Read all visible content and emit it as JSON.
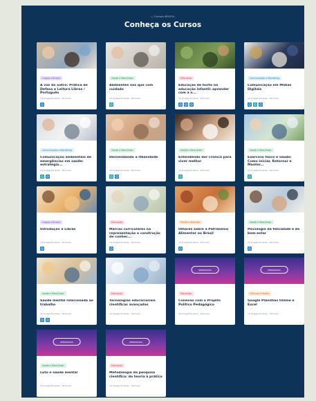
{
  "header": {
    "overline": "○ Cursos MOOCs",
    "title": "Conheça os Cursos"
  },
  "cards": [
    {
      "category": "Língua e Ensino",
      "cat": "lang",
      "title": "A voz do outro: Prática de Defesa e Leitura Libras / Português",
      "meta": "10 Cargas Horárias · 40 horas",
      "icons": [
        "blue"
      ],
      "image": "girl-studying"
    },
    {
      "category": "Saúde e Bem-Estar",
      "cat": "health",
      "title": "Ambientes nos que com cuidado",
      "meta": "10 Cargas Horárias · 30 horas",
      "icons": [
        "teal"
      ],
      "image": "hands-writing"
    },
    {
      "category": "Educação",
      "cat": "edu",
      "title": "Educação de horta na educação infantil: aprender com a n...",
      "meta": "10 Cargas Horárias · 30 horas",
      "icons": [
        "blue",
        "blue",
        "blue"
      ],
      "image": "garden-plants"
    },
    {
      "category": "Comunicação e Marketing",
      "cat": "comm",
      "title": "Comunicação em Mídias Digitais",
      "meta": "10 Cargas Horárias · 30 horas",
      "icons": [
        "blue",
        "teal",
        "blue"
      ],
      "image": "book-dark"
    },
    {
      "category": "Comunicação e Marketing",
      "cat": "comm",
      "title": "Comunicação ambientais de emergências em saúde: estratégia...",
      "meta": "10 Cargas Horárias · 30 horas",
      "icons": [
        "teal",
        "blue"
      ],
      "image": "paperwork"
    },
    {
      "category": "Saúde e Bem-Estar",
      "cat": "health",
      "title": "Desvendando a Obesidade",
      "meta": "10 Cargas Horárias · 30 horas",
      "icons": [
        "teal",
        "blue"
      ],
      "image": "belly"
    },
    {
      "category": "Saúde e Bem-Estar",
      "cat": "health",
      "title": "Entendendo dor crônica para viver melhor",
      "meta": "10 Cargas Horárias · 30 horas",
      "icons": [
        "teal"
      ],
      "image": "knee-pain"
    },
    {
      "category": "Saúde e Bem-Estar",
      "cat": "health",
      "title": "Exercício físico e saúde: Como iniciar, Retornar e Manter...",
      "meta": "10 Cargas Horárias · 30 horas",
      "icons": [
        "teal"
      ],
      "image": "stretching"
    },
    {
      "category": "Língua e Ensino",
      "cat": "lang",
      "title": "Introdução à Libras",
      "meta": "10 Cargas Horárias · 40 horas",
      "icons": [
        "blue"
      ],
      "image": "classroom"
    },
    {
      "category": "Educação",
      "cat": "edu",
      "title": "Marcas curriculares na representação e construção de conhec...",
      "meta": "10 Cargas Horárias · 30 horas",
      "icons": [
        "blue"
      ],
      "image": "desk-map"
    },
    {
      "category": "Saúde e Nutrição",
      "cat": "bw",
      "title": "Olhares sobre a Patrimônio Alimentar no Brasil",
      "meta": "10 Cargas Horárias · 30 horas",
      "icons": [
        "blue"
      ],
      "image": "food-table"
    },
    {
      "category": "Saúde e Bem-Estar",
      "cat": "health",
      "title": "Psicologia da felicidade e do bem-estar",
      "meta": "10 Cargas Horárias · 30 horas",
      "icons": [
        "blue"
      ],
      "image": "group-people"
    },
    {
      "category": "Saúde e Bem-Estar",
      "cat": "health",
      "title": "Saúde mental relacionada ao trabalho",
      "meta": "10 Cargas Horárias · 30 horas",
      "icons": [
        "blue",
        "blue"
      ],
      "image": "kids-lab"
    },
    {
      "category": "Educação",
      "cat": "edu",
      "title": "Tecnologias educacionais científicas avançadas",
      "meta": "10 Cargas Horárias · 30 horas",
      "icons": [],
      "image": "lab-bottles"
    },
    {
      "category": "Educação",
      "cat": "edu",
      "title": "Conexão com o Projeto Político Pedagógico",
      "meta": "10 Cargas Horárias · 30 horas",
      "icons": [],
      "image": "banner",
      "banner_label": "SEMINÁRIOS"
    },
    {
      "category": "Ciências e Saúde",
      "cat": "bw",
      "title": "Google Planilhas Online e Excel",
      "meta": "10 Cargas Horárias · 30 horas",
      "icons": [],
      "image": "banner",
      "banner_label": "SEMINÁRIOS"
    },
    {
      "category": "Saúde e Bem-Estar",
      "cat": "health",
      "title": "Luto e saúde mental",
      "meta": "10 Cargas Horárias · 30 horas",
      "icons": [],
      "image": "banner",
      "banner_label": "SEMINÁRIOS"
    },
    {
      "category": "Educação",
      "cat": "edu",
      "title": "Metodologia da pesquisa científica: do teoria à prática",
      "meta": "10 Cargas Horárias · 30 horas",
      "icons": [],
      "image": "banner",
      "banner_label": "SEMINÁRIOS"
    }
  ]
}
